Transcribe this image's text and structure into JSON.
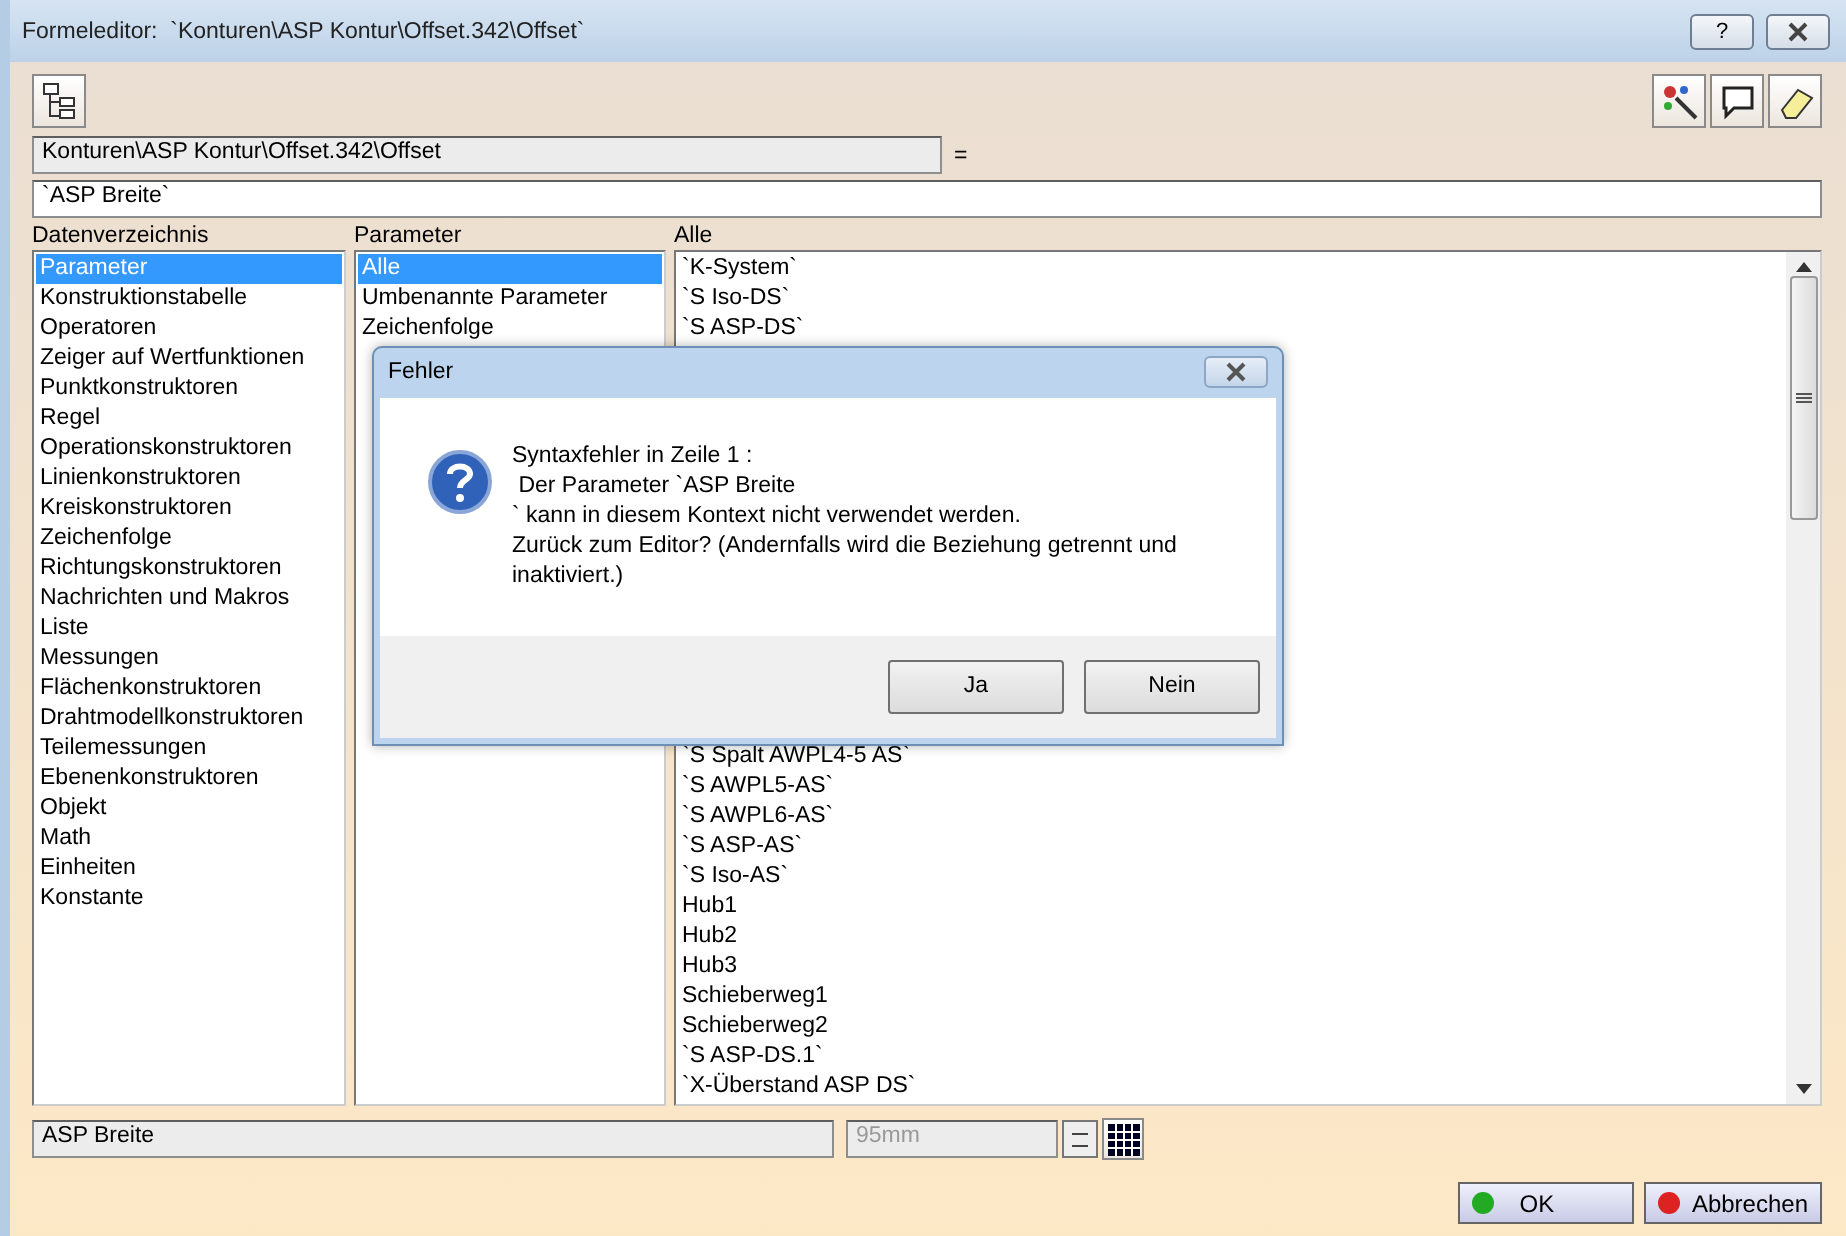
{
  "window": {
    "title": "Formeleditor:  `Konturen\\ASP Kontur\\Offset.342\\Offset`",
    "buttons": [
      "?"
    ]
  },
  "toolbar": {
    "left_icons": [
      {
        "kind": "tree"
      }
    ],
    "right_icons": [
      {
        "kind": "wand"
      },
      {
        "kind": "speech"
      },
      {
        "kind": "eraser"
      }
    ]
  },
  "path_field": {
    "value": "Konturen\\ASP Kontur\\Offset.342\\Offset",
    "suffix": "="
  },
  "formula_field": {
    "value": "`ASP Breite`"
  },
  "lists": [
    {
      "heading": "Datenverzeichnis",
      "items": [
        {
          "label": "Parameter",
          "selected": true
        },
        {
          "label": "Konstruktionstabelle",
          "selected": false
        },
        {
          "label": "Operatoren",
          "selected": false
        },
        {
          "label": "Zeiger auf Wertfunktionen",
          "selected": false
        },
        {
          "label": "Punktkonstruktoren",
          "selected": false
        },
        {
          "label": "Regel",
          "selected": false
        },
        {
          "label": "Operationskonstruktoren",
          "selected": false
        },
        {
          "label": "Linienkonstruktoren",
          "selected": false
        },
        {
          "label": "Kreiskonstruktoren",
          "selected": false
        },
        {
          "label": "Zeichenfolge",
          "selected": false
        },
        {
          "label": "Richtungskonstruktoren",
          "selected": false
        },
        {
          "label": "Nachrichten und Makros",
          "selected": false
        },
        {
          "label": "Liste",
          "selected": false
        },
        {
          "label": "Messungen",
          "selected": false
        },
        {
          "label": "Flächenkonstruktoren",
          "selected": false
        },
        {
          "label": "Drahtmodellkonstruktoren",
          "selected": false
        },
        {
          "label": "Teilemessungen",
          "selected": false
        },
        {
          "label": "Ebenenkonstruktoren",
          "selected": false
        },
        {
          "label": "Objekt",
          "selected": false
        },
        {
          "label": "Math",
          "selected": false
        },
        {
          "label": "Einheiten",
          "selected": false
        },
        {
          "label": "Konstante",
          "selected": false
        }
      ]
    },
    {
      "heading": "Parameter",
      "items": [
        {
          "label": "Alle",
          "selected": true
        },
        {
          "label": "Umbenannte Parameter",
          "selected": false
        },
        {
          "label": "Zeichenfolge",
          "selected": false
        }
      ]
    },
    {
      "heading": "Alle",
      "items": [
        {
          "label": "`K-System`",
          "selected": false
        },
        {
          "label": "`S Iso-DS`",
          "selected": false
        },
        {
          "label": "`S ASP-DS`",
          "selected": false
        }
      ],
      "items_below": [
        {
          "label": "`S Spalt AWPL4-5 AS`",
          "selected": false
        },
        {
          "label": "`S AWPL5-AS`",
          "selected": false
        },
        {
          "label": "`S AWPL6-AS`",
          "selected": false
        },
        {
          "label": "`S ASP-AS`",
          "selected": false
        },
        {
          "label": "`S Iso-AS`",
          "selected": false
        },
        {
          "label": "Hub1",
          "selected": false
        },
        {
          "label": "Hub2",
          "selected": false
        },
        {
          "label": "Hub3",
          "selected": false
        },
        {
          "label": "Schieberweg1",
          "selected": false
        },
        {
          "label": "Schieberweg2",
          "selected": false
        },
        {
          "label": "`S ASP-DS.1`",
          "selected": false
        },
        {
          "label": "`X-Überstand ASP DS`",
          "selected": false
        }
      ]
    }
  ],
  "value_row": {
    "name": "ASP Breite",
    "value": "95mm",
    "disabled": true
  },
  "buttons": [
    {
      "label": "OK",
      "color": "#22aa22"
    },
    {
      "label": "Abbrechen",
      "color": "#dd2222"
    }
  ],
  "dialog": {
    "title": "Fehler",
    "lines": [
      "Syntaxfehler in Zeile 1 :",
      " Der Parameter `ASP Breite",
      "` kann in diesem Kontext nicht verwendet werden.",
      "Zurück zum Editor? (Andernfalls wird die Beziehung getrennt und inaktiviert.)"
    ],
    "buttons": [
      "Ja",
      "Nein"
    ]
  }
}
